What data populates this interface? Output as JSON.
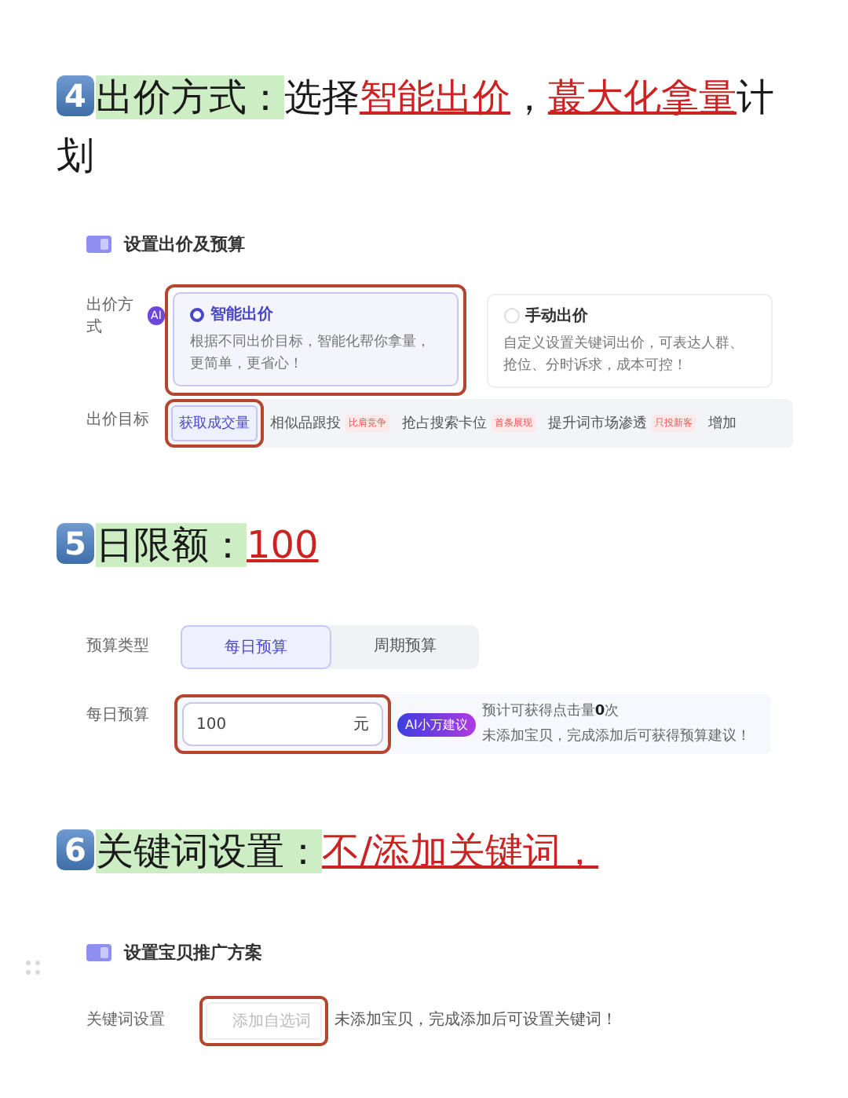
{
  "blocks": [
    {
      "kind": "step",
      "number": "4",
      "label": "出价方式：",
      "parts": [
        {
          "text": "选择",
          "emphasis": false
        },
        {
          "text": "智能出价",
          "emphasis": true
        },
        {
          "text": "，",
          "emphasis": false
        },
        {
          "text": "蕞大化拿量",
          "emphasis": true
        },
        {
          "text": "计划",
          "emphasis": false
        }
      ]
    },
    {
      "kind": "bid_panel",
      "title": "设置出价及预算",
      "method_label": "出价方式",
      "method_badge": "AI",
      "options": [
        {
          "title": "智能出价",
          "desc": "根据不同出价目标，智能化帮你拿量，更简单，更省心！",
          "selected": true,
          "highlighted": true
        },
        {
          "title": "手动出价",
          "desc": "自定义设置关键词出价，可表达人群、抢位、分时诉求，成本可控！",
          "selected": false,
          "highlighted": false
        }
      ],
      "goal_label": "出价目标",
      "goals": [
        {
          "label": "获取成交量",
          "selected": true,
          "highlighted": true
        },
        {
          "label": "相似品跟投",
          "tag": "比肩竞争",
          "selected": false,
          "highlighted": false
        },
        {
          "label": "抢占搜索卡位",
          "tag": "首条展现",
          "selected": false,
          "highlighted": false
        },
        {
          "label": "提升词市场渗透",
          "tag": "只投新客",
          "selected": false,
          "highlighted": false
        },
        {
          "label": "增加",
          "selected": false,
          "highlighted": false
        }
      ]
    },
    {
      "kind": "step",
      "number": "5",
      "label": "日限额：",
      "parts": [
        {
          "text": "100",
          "emphasis": true
        }
      ]
    },
    {
      "kind": "budget_panel",
      "type_label": "预算类型",
      "types": [
        {
          "label": "每日预算",
          "selected": true
        },
        {
          "label": "周期预算",
          "selected": false
        }
      ],
      "amount_label": "每日预算",
      "amount": {
        "value": "100",
        "unit": "元",
        "highlighted": true
      },
      "ai_badge": "AI小万建议",
      "hint_lines": [
        "预计可获得点击量**0**次",
        "未添加宝贝，完成添加后可获得预算建议！"
      ]
    },
    {
      "kind": "step",
      "number": "6",
      "label": "关键词设置：",
      "parts": [
        {
          "text": "不/添加关键词，",
          "emphasis": true
        }
      ]
    },
    {
      "kind": "keyword_panel",
      "title": "设置宝贝推广方案",
      "row_label": "关键词设置",
      "button": {
        "label": "添加自选词",
        "disabled": true,
        "highlighted": true
      },
      "note": "未添加宝贝，完成添加后可设置关键词！"
    }
  ]
}
